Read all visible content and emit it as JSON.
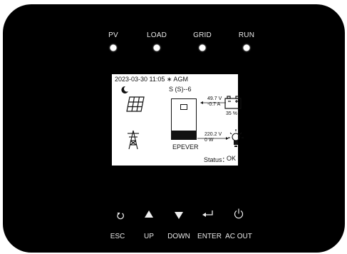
{
  "indicators": [
    {
      "label": "PV"
    },
    {
      "label": "LOAD"
    },
    {
      "label": "GRID"
    },
    {
      "label": "RUN"
    }
  ],
  "lcd": {
    "header": "2023-03-30  11:05 ∗ AGM",
    "mode": "S (S)--6",
    "battery_voltage": "49.7 V",
    "battery_current": "-0.7  A",
    "battery_soc": "35 %",
    "load_voltage": "220.2 V",
    "load_power": "0  W",
    "brand": "EPEVER",
    "status_label": "Status：",
    "status_value": "OK"
  },
  "buttons": [
    {
      "label": "ESC",
      "icon": "back-arrow-icon"
    },
    {
      "label": "UP",
      "icon": "up-triangle-icon"
    },
    {
      "label": "DOWN",
      "icon": "down-triangle-icon"
    },
    {
      "label": "ENTER",
      "icon": "enter-icon"
    },
    {
      "label": "AC OUT",
      "icon": "power-icon"
    }
  ],
  "colors": {
    "panel": "#000000",
    "lcd": "#ffffff",
    "led": "#ffffff"
  }
}
